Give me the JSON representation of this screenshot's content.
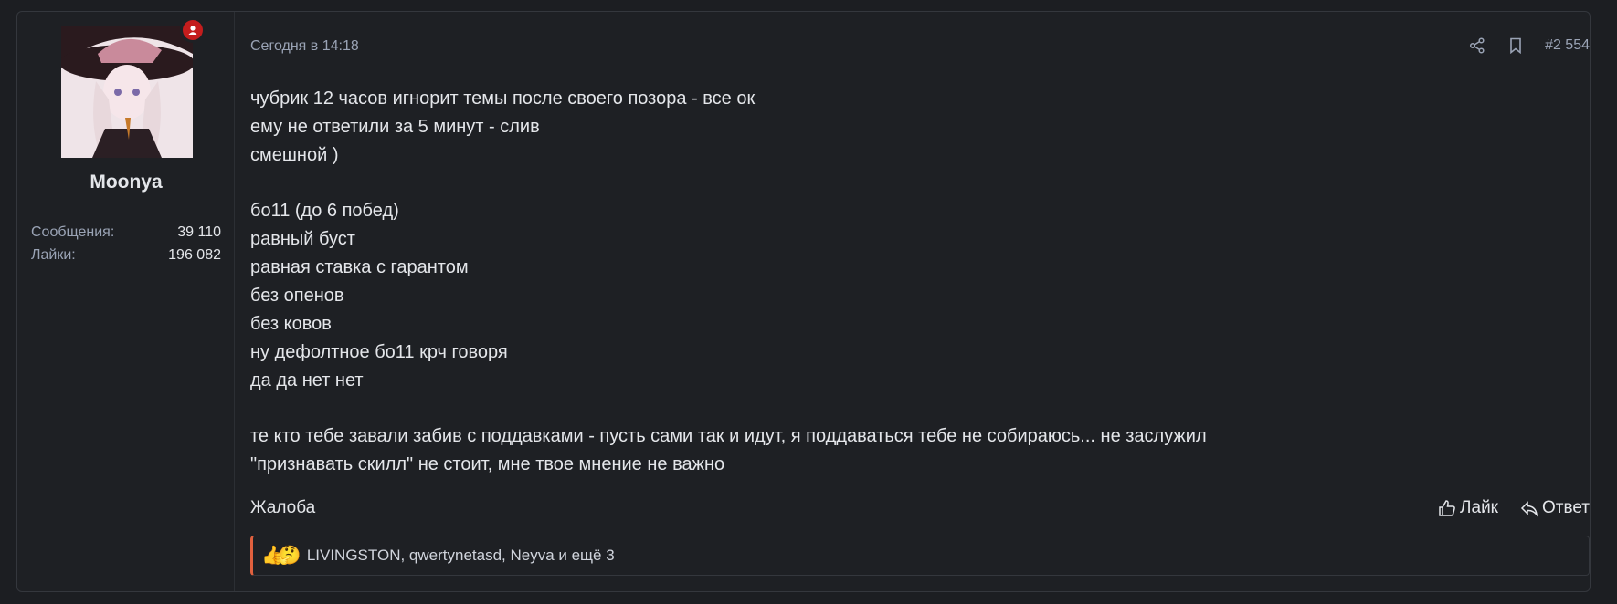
{
  "user": {
    "name": "Moonya",
    "stats": [
      {
        "label": "Сообщения:",
        "value": "39 110"
      },
      {
        "label": "Лайки:",
        "value": "196 082"
      }
    ]
  },
  "post": {
    "date": "Сегодня в 14:18",
    "number": "#2 554",
    "paragraphs": [
      [
        "чубрик 12 часов игнорит темы после своего позора - все ок",
        "ему не ответили за 5 минут - слив",
        "смешной )"
      ],
      [
        "бо11 (до 6 побед)",
        "равный буст",
        "равная ставка с гарантом",
        "без опенов",
        "без ковов",
        "ну дефолтное бо11 крч говоря",
        "да да нет нет"
      ],
      [
        "те кто тебе завали забив с поддавками - пусть сами так и идут, я поддаваться тебе не собираюсь... не заслужил",
        "\"признавать скилл\" не стоит, мне твое мнение не важно"
      ]
    ]
  },
  "footer": {
    "report_label": "Жалоба",
    "like_label": "Лайк",
    "reply_label": "Ответ"
  },
  "reactions": {
    "icons": [
      "👍",
      "🤔"
    ],
    "text": "LIVINGSTON, qwertynetasd, Neyva и ещё 3"
  },
  "colors": {
    "background": "#1e2024",
    "text": "#e4e6ea",
    "muted": "#9aa3b5",
    "online_badge": "#c41d1d",
    "reaction_accent": "#e0603e"
  }
}
